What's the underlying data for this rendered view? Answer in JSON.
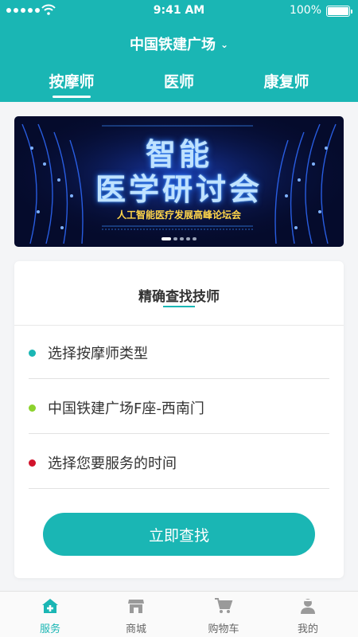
{
  "status_bar": {
    "time": "9:41 AM",
    "battery": "100%"
  },
  "header": {
    "location": "中国铁建广场",
    "tabs": [
      {
        "label": "按摩师"
      },
      {
        "label": "医师"
      },
      {
        "label": "康复师"
      }
    ],
    "active_tab": 0
  },
  "banner": {
    "title_line1": "智能",
    "title_line2": "医学研讨会",
    "subtitle": "人工智能医疗发展高峰论坛会",
    "page_count": 5,
    "active_page": 1
  },
  "finder": {
    "title": "精确查找技师",
    "rows": [
      {
        "label": "选择按摩师类型",
        "dot_color": "#1ab6b4"
      },
      {
        "label": "中国铁建广场F座-西南门",
        "dot_color": "#8cd22d"
      },
      {
        "label": "选择您要服务的时间",
        "dot_color": "#d1132b"
      }
    ],
    "button_label": "立即查找"
  },
  "tabbar": {
    "items": [
      {
        "label": "服务",
        "icon": "service-icon"
      },
      {
        "label": "商城",
        "icon": "store-icon"
      },
      {
        "label": "购物车",
        "icon": "cart-icon"
      },
      {
        "label": "我的",
        "icon": "profile-icon"
      }
    ],
    "active": 0
  },
  "colors": {
    "accent": "#1ab6b4",
    "background": "#f4f5f7"
  }
}
